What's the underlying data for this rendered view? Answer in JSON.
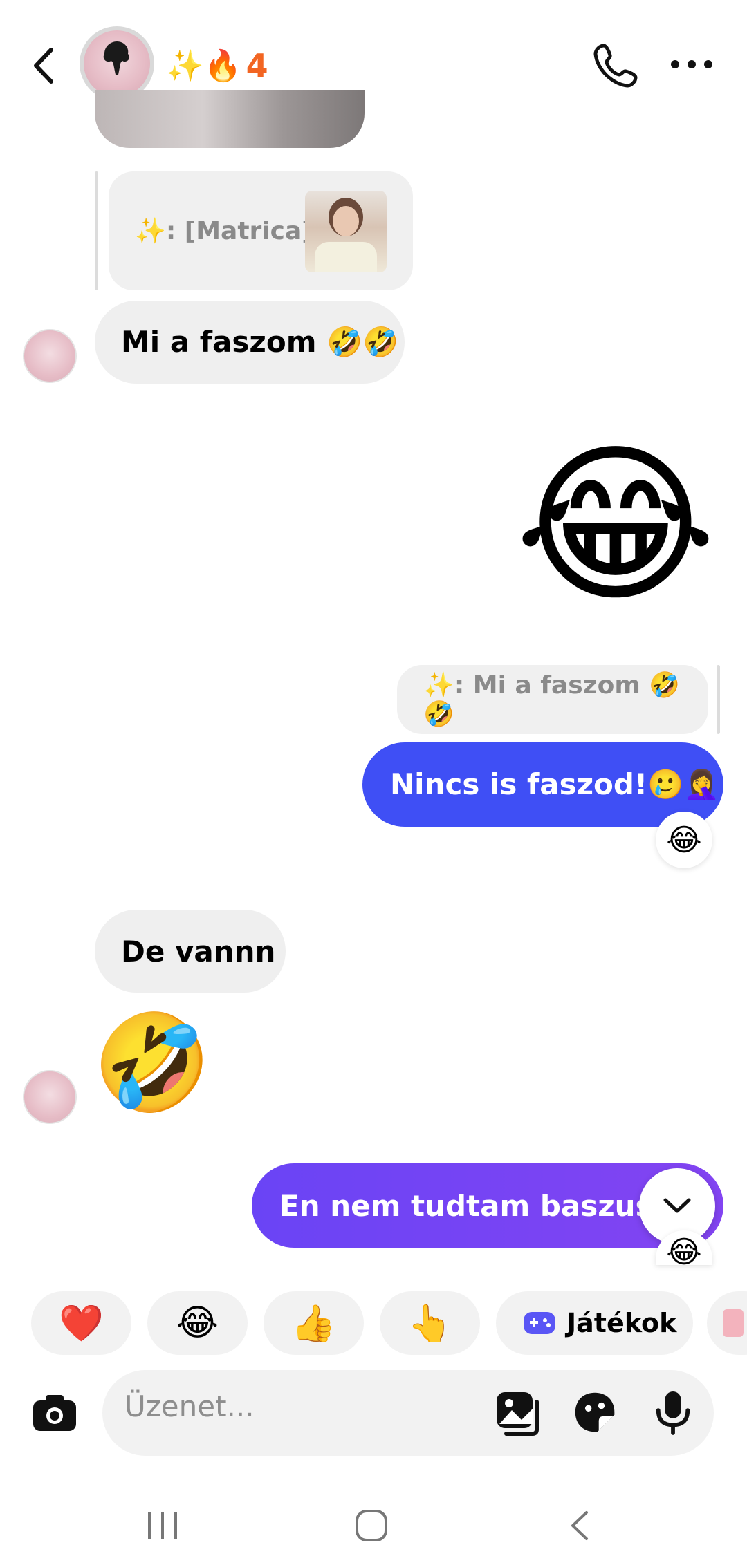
{
  "header": {
    "streak_emoji": "✨🔥",
    "streak_count": "4"
  },
  "messages": {
    "reply1_label": "✨: [Matrica]",
    "msg1_text": "Mi a faszom 🤣🤣",
    "big_emoji": "😂",
    "reply2_label": "✨: Mi a faszom 🤣🤣",
    "msg2_text": "Nincs is faszod!🥲🤦‍♀️",
    "msg2_reaction": "😂",
    "msg3_text": "De vannn",
    "msg4_emoji": "🤣",
    "msg5_text": "En nem tudtam baszusss",
    "msg5_reaction": "😂"
  },
  "quick_reactions": [
    "❤️",
    "😂",
    "👍",
    "👆"
  ],
  "games_label": "Játékok",
  "composer": {
    "placeholder": "Üzenet..."
  },
  "colors": {
    "outgoing_blue": "#3f4ff5",
    "outgoing_purple": "#7a3ff5",
    "streak_orange": "#f26522"
  }
}
